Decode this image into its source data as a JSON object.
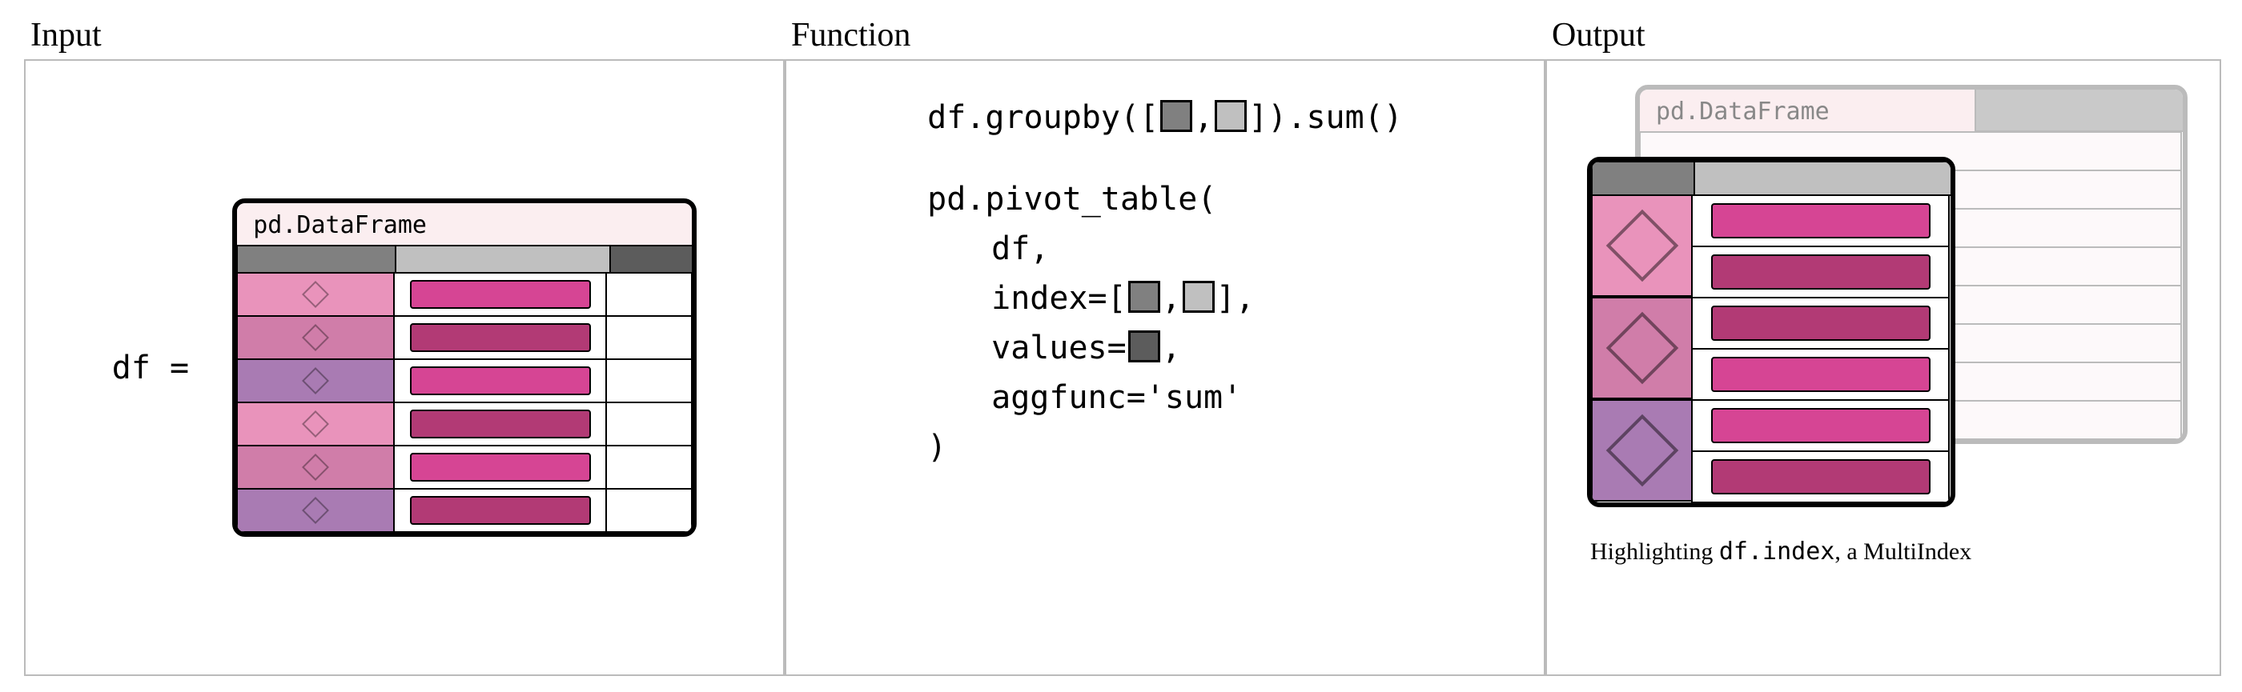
{
  "panels": {
    "input": {
      "title": "Input"
    },
    "function": {
      "title": "Function"
    },
    "output": {
      "title": "Output"
    }
  },
  "input": {
    "assign": "df = ",
    "df_label": "pd.DataFrame",
    "columns": [
      {
        "color": "gray-dark"
      },
      {
        "color": "gray-light"
      },
      {
        "color": "gray-darker"
      }
    ],
    "rows": [
      {
        "idx_color": "pink1",
        "val_color": "mag1"
      },
      {
        "idx_color": "pink2",
        "val_color": "mag2"
      },
      {
        "idx_color": "pink3",
        "val_color": "mag3"
      },
      {
        "idx_color": "pink1",
        "val_color": "mag2"
      },
      {
        "idx_color": "pink2",
        "val_color": "mag1"
      },
      {
        "idx_color": "pink3",
        "val_color": "mag2"
      }
    ]
  },
  "function": {
    "line1": {
      "pre": "df.groupby([",
      "mid": ",",
      "post": "]).sum()"
    },
    "pivot": {
      "l1": "pd.pivot_table(",
      "l2": "df,",
      "l3_pre": "index=[",
      "l3_mid": ",",
      "l3_post": "],",
      "l4_pre": "values=",
      "l4_post": ",",
      "l5": "aggfunc='sum'",
      "l6": ")"
    }
  },
  "output": {
    "df_label": "pd.DataFrame",
    "caption_pre": "Highlighting ",
    "caption_code": "df.index",
    "caption_post": ", a MultiIndex",
    "index_groups": [
      {
        "color": "pink1",
        "rows": [
          "mag1",
          "mag2"
        ]
      },
      {
        "color": "pink2",
        "rows": [
          "mag2",
          "mag1"
        ]
      },
      {
        "color": "pink3",
        "rows": [
          "mag1",
          "mag2"
        ]
      }
    ]
  }
}
